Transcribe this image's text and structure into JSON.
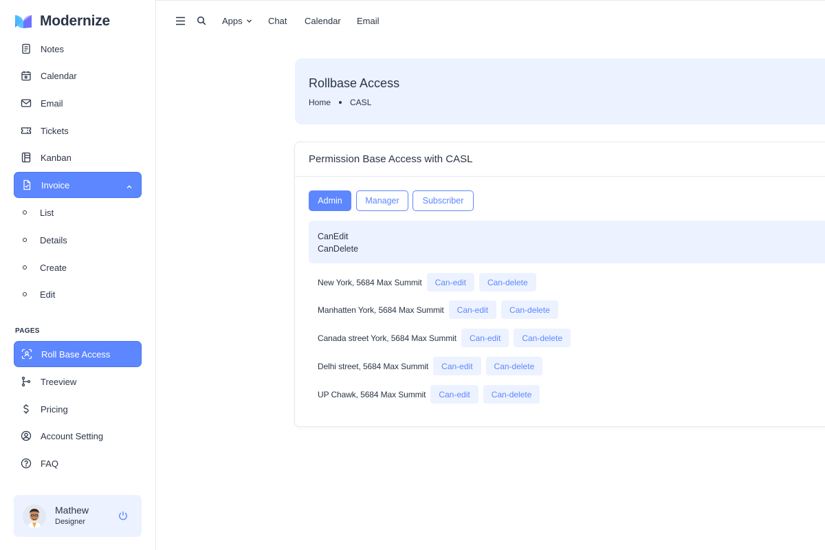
{
  "brand": {
    "name": "Modernize"
  },
  "sidebar": {
    "items": [
      {
        "label": "Notes",
        "icon": "notes-icon"
      },
      {
        "label": "Calendar",
        "icon": "calendar-icon"
      },
      {
        "label": "Email",
        "icon": "mail-icon"
      },
      {
        "label": "Tickets",
        "icon": "ticket-icon"
      },
      {
        "label": "Kanban",
        "icon": "kanban-icon"
      },
      {
        "label": "Invoice",
        "icon": "invoice-icon",
        "active": true,
        "expanded": true
      }
    ],
    "invoice_sub": [
      "List",
      "Details",
      "Create",
      "Edit"
    ],
    "section_pages": "PAGES",
    "pages": [
      {
        "label": "Roll Base Access",
        "icon": "user-scan-icon",
        "active": true
      },
      {
        "label": "Treeview",
        "icon": "git-branch-icon"
      },
      {
        "label": "Pricing",
        "icon": "dollar-icon"
      },
      {
        "label": "Account Setting",
        "icon": "user-circle-icon"
      },
      {
        "label": "FAQ",
        "icon": "help-circle-icon"
      }
    ]
  },
  "profile": {
    "name": "Mathew",
    "role": "Designer"
  },
  "topbar": {
    "links": {
      "apps": "Apps",
      "chat": "Chat",
      "calendar": "Calendar",
      "email": "Email"
    }
  },
  "page": {
    "title": "Rollbase Access",
    "breadcrumb": [
      "Home",
      "CASL"
    ]
  },
  "card": {
    "title": "Permission Base Access with CASL",
    "roles": [
      "Admin",
      "Manager",
      "Subscriber"
    ],
    "active_role": "Admin",
    "permissions": [
      "CanEdit",
      "CanDelete"
    ],
    "rows": [
      {
        "address": "New York, 5684 Max Summit",
        "edit": "Can-edit",
        "delete": "Can-delete"
      },
      {
        "address": "Manhatten York, 5684 Max Summit",
        "edit": "Can-edit",
        "delete": "Can-delete"
      },
      {
        "address": "Canada street York, 5684 Max Summit",
        "edit": "Can-edit",
        "delete": "Can-delete"
      },
      {
        "address": "Delhi street, 5684 Max Summit",
        "edit": "Can-edit",
        "delete": "Can-delete"
      },
      {
        "address": "UP Chawk, 5684 Max Summit",
        "edit": "Can-edit",
        "delete": "Can-delete"
      }
    ]
  },
  "colors": {
    "primary": "#5d87ff",
    "light_primary": "#ecf2ff",
    "text": "#2a3547",
    "border": "#e5eaef"
  }
}
